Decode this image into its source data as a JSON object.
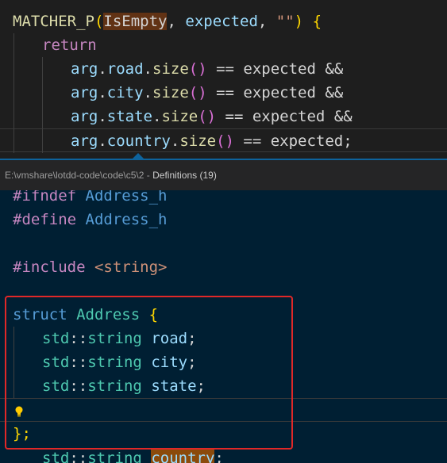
{
  "editor": {
    "macro_name": "MATCHER_P",
    "macro_arg1": "IsEmpty",
    "macro_arg2": "expected",
    "macro_arg3": "\"\"",
    "return_kw": "return",
    "lines": [
      {
        "obj": "arg",
        "field": "road",
        "method": "size",
        "rest": "== expected &&"
      },
      {
        "obj": "arg",
        "field": "city",
        "method": "size",
        "rest": "== expected &&"
      },
      {
        "obj": "arg",
        "field": "state",
        "method": "size",
        "rest": "== expected &&"
      },
      {
        "obj": "arg",
        "field": "country",
        "method": "size",
        "rest": "== expected;"
      }
    ]
  },
  "peek": {
    "path": "E:\\vmshare\\lotdd-code\\code\\c5\\2",
    "separator": " - ",
    "title": "Definitions (19)",
    "ifndef": "#ifndef",
    "define": "#define",
    "guard": "Address_h",
    "include": "#include",
    "include_file": "<string>",
    "struct_kw": "struct",
    "struct_name": "Address",
    "namespace": "std",
    "scope": "::",
    "type": "string",
    "fields": [
      "road",
      "city",
      "state",
      "country"
    ],
    "close": "};"
  },
  "colors": {
    "accent": "#0e639c",
    "highlight_box": "#e02828",
    "peek_background": "#001f33"
  }
}
